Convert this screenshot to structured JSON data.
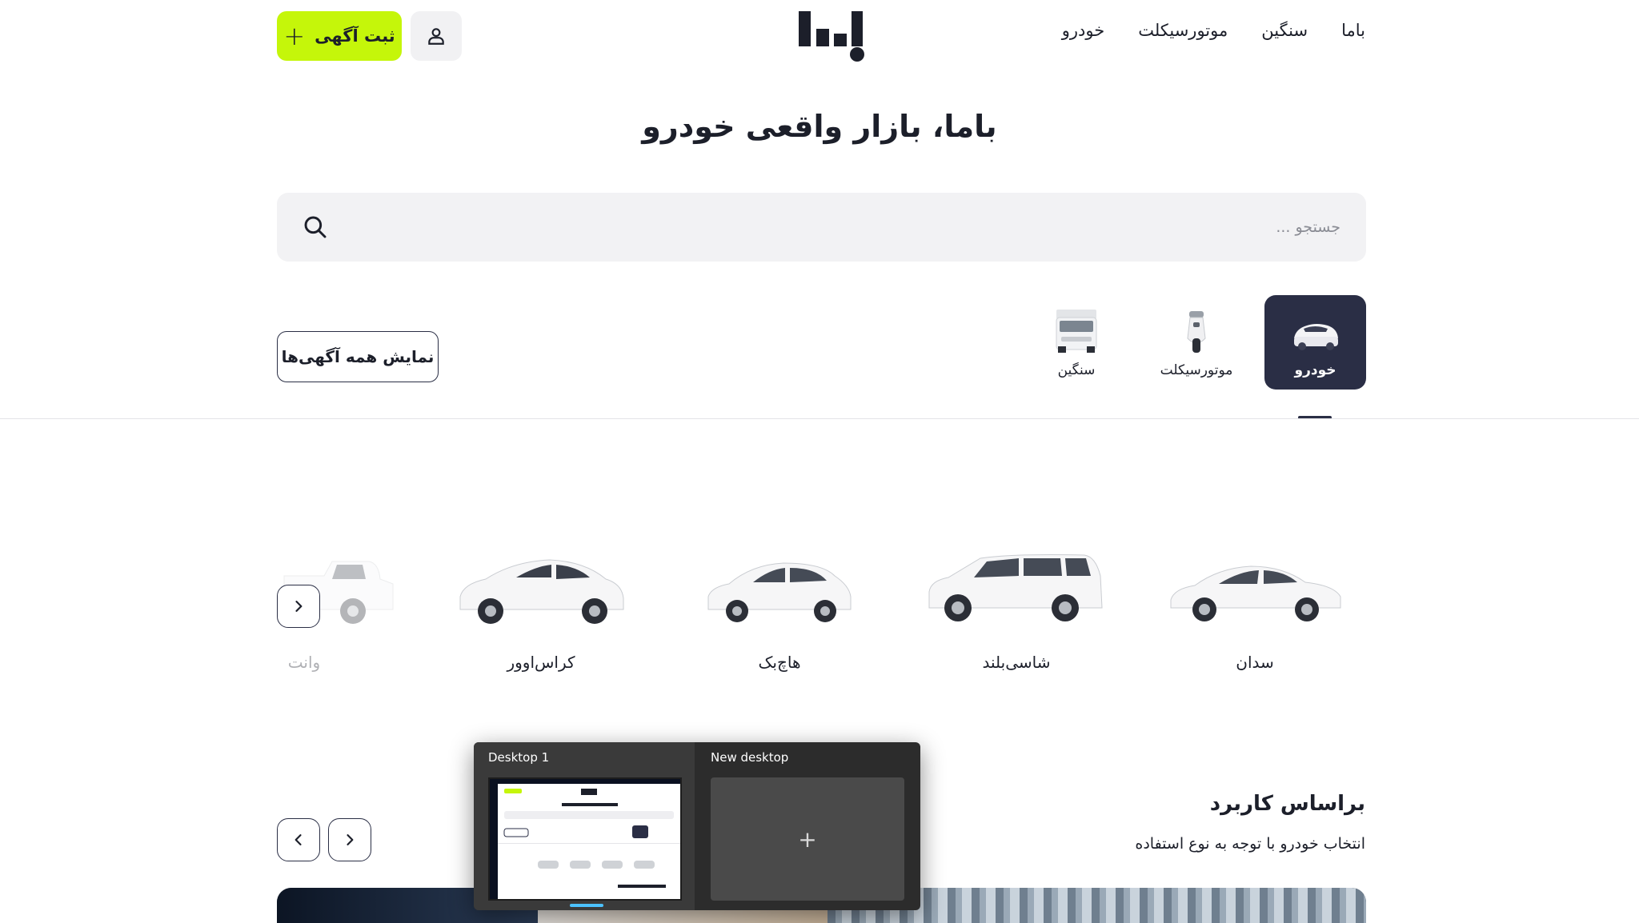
{
  "header": {
    "nav": [
      "خودرو",
      "موتورسیکلت",
      "سنگین",
      "باما"
    ],
    "post_ad_label": "ثبت آگهی"
  },
  "page_title": "باما، بازار واقعی خودرو",
  "search": {
    "placeholder": "جستجو ..."
  },
  "categories": [
    {
      "label": "خودرو",
      "active": true
    },
    {
      "label": "موتورسیکلت",
      "active": false
    },
    {
      "label": "سنگین",
      "active": false
    }
  ],
  "show_all_label": "نمایش همه آگهی‌ها",
  "body_types": [
    {
      "label": "سدان"
    },
    {
      "label": "شاسی‌بلند"
    },
    {
      "label": "هاچ‌بک"
    },
    {
      "label": "کراس‌اوور"
    },
    {
      "label": "وانت"
    }
  ],
  "section": {
    "title": "براساس کاربرد",
    "subtitle": "انتخاب خودرو با توجه به نوع استفاده"
  },
  "taskview": {
    "desktop1_label": "Desktop 1",
    "new_desktop_label": "New desktop",
    "add_symbol": "+"
  },
  "colors": {
    "accent": "#c5f60a",
    "dark": "#2a2e45",
    "search_bg": "#f2f2f4"
  }
}
